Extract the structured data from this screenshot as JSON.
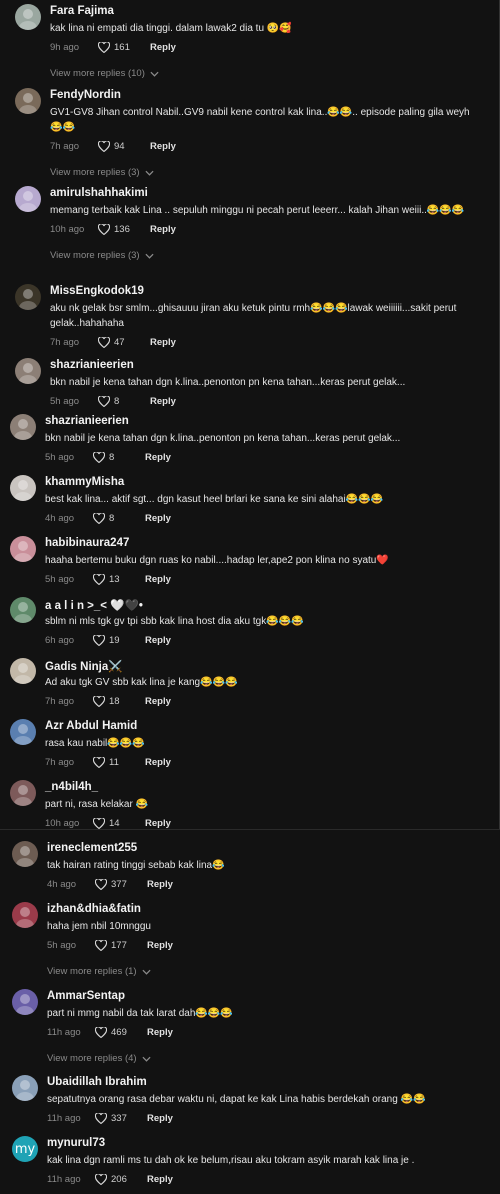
{
  "comments": [
    {
      "user": "Fara Fajima",
      "text": "kak lina ni empati dia tinggi. dalam lawak2 dia tu 🥺🥰",
      "time": "9h ago",
      "likes": "161",
      "reply": "Reply",
      "more": "View more replies (10)",
      "avatar_color": "#9aa7a0"
    },
    {
      "user": "FendyNordin",
      "text": "GV1-GV8 Jihan control Nabil..GV9 nabil kene control kak lina..😂😂.. episode paling gila weyh😂😂",
      "time": "7h ago",
      "likes": "94",
      "reply": "Reply",
      "more": "View more replies (3)",
      "avatar_color": "#7a6a5a"
    },
    {
      "user": "amirulshahhakimi",
      "text": "memang terbaik kak Lina .. sepuluh minggu ni pecah perut leeerr... kalah Jihan weiii..😂😂😂",
      "time": "10h ago",
      "likes": "136",
      "reply": "Reply",
      "more": "View more replies (3)",
      "avatar_color": "#b7a9cf"
    },
    {
      "user": "MissEngkodok19",
      "text": "aku nk gelak bsr smlm...ghisauuu jiran aku ketuk pintu rmh😂😂😂lawak weiiiiii...sakit perut gelak..hahahaha",
      "time": "7h ago",
      "likes": "47",
      "reply": "Reply",
      "more": "",
      "avatar_color": "#3b3528"
    },
    {
      "user": "shazrianieerien",
      "text": "bkn nabil je kena tahan dgn k.lina..penonton pn kena tahan...keras perut gelak...",
      "time": "5h ago",
      "likes": "8",
      "reply": "Reply",
      "more": "",
      "avatar_color": "#8c7f76"
    },
    {
      "user": "shazrianieerien",
      "text": "bkn nabil je kena tahan dgn k.lina..penonton pn kena tahan...keras perut gelak...",
      "time": "5h ago",
      "likes": "8",
      "reply": "Reply",
      "more": "",
      "avatar_color": "#8c7f76"
    },
    {
      "user": "khammyMisha",
      "text": "best kak lina... aktif sgt... dgn kasut heel brlari ke sana ke sini alahai😂😂😂",
      "time": "4h ago",
      "likes": "8",
      "reply": "Reply",
      "more": "",
      "avatar_color": "#c9c4c0"
    },
    {
      "user": "habibinaura247",
      "text": "haaha bertemu buku dgn ruas ko nabil....hadap ler,ape2 pon klina no syatu❤️",
      "time": "5h ago",
      "likes": "13",
      "reply": "Reply",
      "more": "",
      "avatar_color": "#c98f9a"
    },
    {
      "user": "a a l i n >_< 🤍🖤•",
      "text": "sblm ni mls tgk gv tpi sbb kak lina host dia aku tgk😂😂😂",
      "time": "6h ago",
      "likes": "19",
      "reply": "Reply",
      "more": "",
      "avatar_color": "#5f8a6a"
    },
    {
      "user": "Gadis Ninja⚔️",
      "text": "Ad aku tgk GV sbb kak lina je kang😂😂😂",
      "time": "7h ago",
      "likes": "18",
      "reply": "Reply",
      "more": "",
      "avatar_color": "#c2b8a8"
    },
    {
      "user": "Azr Abdul Hamid",
      "text": "rasa kau nabil😂😂😂",
      "time": "7h ago",
      "likes": "11",
      "reply": "Reply",
      "more": "",
      "avatar_color": "#5a7fb0"
    },
    {
      "user": "_n4bil4h_",
      "text": "part ni, rasa kelakar 😂",
      "time": "10h ago",
      "likes": "14",
      "reply": "Reply",
      "more": "",
      "avatar_color": "#7d5a5a"
    },
    {
      "user": "ireneclement255",
      "text": "tak hairan rating tinggi sebab kak lina😂",
      "time": "4h ago",
      "likes": "377",
      "reply": "Reply",
      "more": "",
      "avatar_color": "#6d5c52"
    },
    {
      "user": "izhan&dhia&fatin",
      "text": "haha jem nbil 10mnggu",
      "time": "5h ago",
      "likes": "177",
      "reply": "Reply",
      "more": "View more replies (1)",
      "avatar_color": "#9a3b4a"
    },
    {
      "user": "AmmarSentap",
      "text": "part ni mmg nabil da tak larat dah😂😂😂",
      "time": "11h ago",
      "likes": "469",
      "reply": "Reply",
      "more": "View more replies (4)",
      "avatar_color": "#6a5fa8"
    },
    {
      "user": "Ubaidillah Ibrahim",
      "text": "sepatutnya orang rasa debar waktu ni, dapat ke kak Lina habis berdekah orang 😂😂",
      "time": "11h ago",
      "likes": "337",
      "reply": "Reply",
      "more": "",
      "avatar_color": "#8aa0b8"
    },
    {
      "user": "mynurul73",
      "text": "kak lina dgn ramli ms tu dah ok ke belum,risau aku tokram asyik marah kak lina je .",
      "time": "11h ago",
      "likes": "206",
      "reply": "Reply",
      "more": "",
      "avatar_color": "#1fa3b5",
      "avatar_text": "my"
    }
  ]
}
